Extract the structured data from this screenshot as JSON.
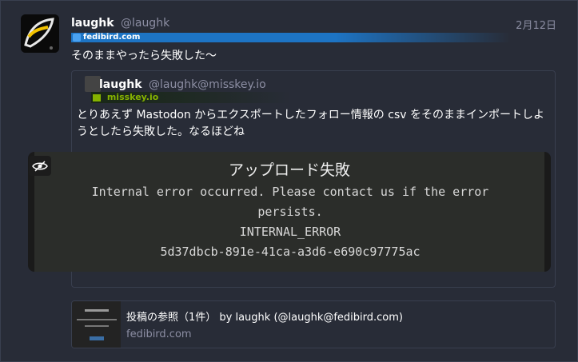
{
  "post": {
    "display_name": "laughk",
    "acct": "@laughk",
    "date": "2月12日",
    "server": "fedibird.com",
    "content": "そのままやったら失敗した〜"
  },
  "quote": {
    "display_name": "laughk",
    "acct": "@laughk@misskey.io",
    "server": "misskey.io",
    "text": "とりあえず Mastodon からエクスポートしたフォロー情報の csv をそのままインポートしようとしたら失敗した。なるほどね",
    "media": {
      "title": "アップロード失敗",
      "message": "Internal error occurred. Please contact us if the error persists.",
      "code": "INTERNAL_ERROR",
      "id": "5d37dbcb-891e-41ca-a3d6-e690c97775ac"
    }
  },
  "card": {
    "title": "投稿の参照（1件） by laughk (@laughk@fedibird.com)",
    "host": "fedibird.com"
  },
  "colors": {
    "background": "#282c37",
    "fedibird_accent": "#1d74c4",
    "misskey_accent": "#86b300",
    "muted_text": "#8c8ea3"
  }
}
